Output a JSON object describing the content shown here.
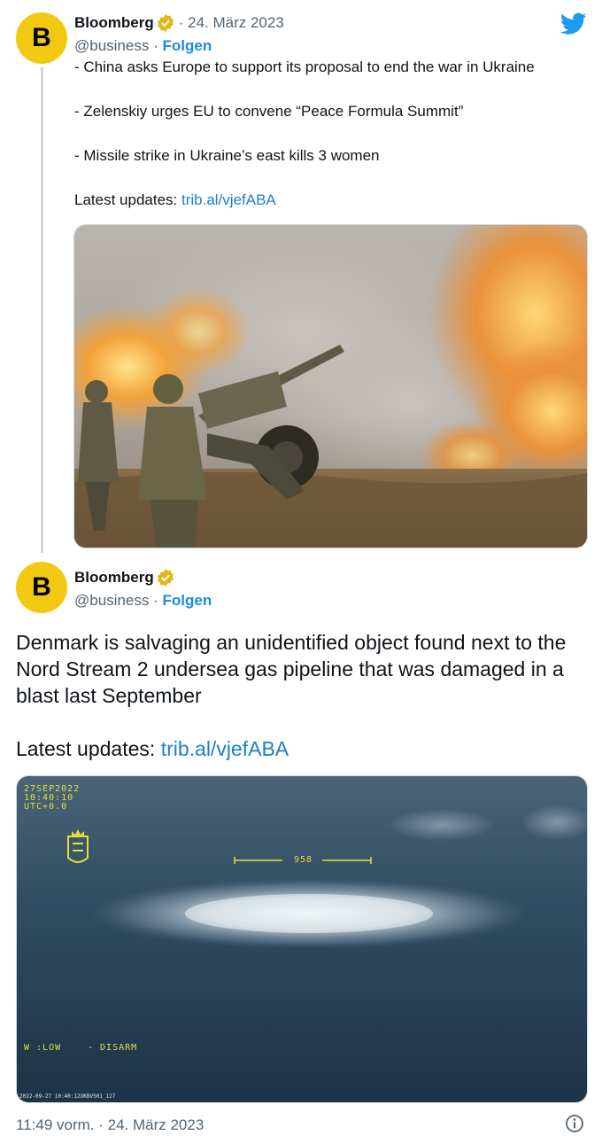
{
  "tweet1": {
    "author": "Bloomberg",
    "avatar_letter": "B",
    "date": "· 24. März 2023",
    "handle": "@business",
    "separator": "·",
    "follow_label": "Folgen",
    "lines": [
      "- China asks Europe to support its proposal to end the war in Ukraine",
      "- Zelenskiy urges EU to convene “Peace Formula Summit”",
      "- Missile strike in Ukraine’s east kills 3 women"
    ],
    "updates_label": "Latest updates:",
    "updates_link": "trib.al/vjefABA",
    "image_icon": "artillery-photo"
  },
  "tweet2": {
    "author": "Bloomberg",
    "avatar_letter": "B",
    "handle": "@business",
    "separator": "·",
    "follow_label": "Folgen",
    "text": "Denmark is salvaging an unidentified object found next to the Nord Stream 2 undersea gas pipeline that was damaged in a blast last September",
    "updates_label": "Latest updates:",
    "updates_link": "trib.al/vjefABA",
    "image": {
      "osd_date": "27SEP2022",
      "osd_time": "10:40:10",
      "osd_utc": "UTC+0.0",
      "scale_value": "958",
      "mode_left": "W :LOW",
      "mode_right": "- DISARM",
      "bottom_code": "2022-09-27 10:40:12UKBV501_127"
    }
  },
  "footer": {
    "timestamp": "11:49 vorm. · 24. März 2023"
  },
  "colors": {
    "accent": "#1d9bf0",
    "avatar_bg": "#f2c811",
    "verified": "#e2b719",
    "text_muted": "#536471"
  },
  "icons": [
    "twitter-bird-icon",
    "verified-badge-icon",
    "info-icon"
  ]
}
